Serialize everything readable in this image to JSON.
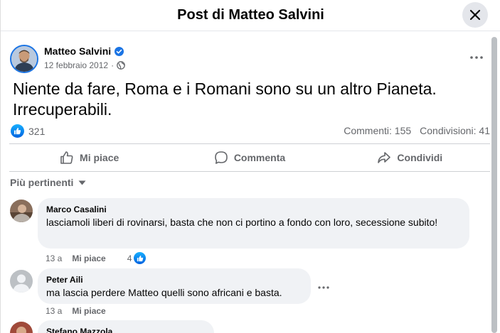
{
  "modal": {
    "title": "Post di Matteo Salvini"
  },
  "post": {
    "author": "Matteo Salvini",
    "date": "12 febbraio 2012",
    "separator": "·",
    "text": "Niente da fare, Roma e i Romani sono su un altro Pianeta. Irrecuperabili.",
    "like_count": "321",
    "comments_label": "Commenti: 155",
    "shares_label": "Condivisioni: 41"
  },
  "actions": {
    "like": "Mi piace",
    "comment": "Commenta",
    "share": "Condividi"
  },
  "sort": {
    "label": "Più pertinenti"
  },
  "comments": [
    {
      "author": "Marco Casalini",
      "text": "lasciamoli liberi di rovinarsi, basta che non ci portino a fondo con loro, secessione subito!",
      "time": "13 a",
      "like_label": "Mi piace",
      "reactions": "4"
    },
    {
      "author": "Peter Aili",
      "text": "ma lascia perdere Matteo quelli sono africani e basta.",
      "time": "13 a",
      "like_label": "Mi piace"
    },
    {
      "author": "Stefano Mazzola"
    }
  ],
  "colors": {
    "accent": "#1b74e4",
    "muted": "#65676b",
    "bubble": "#f0f2f5"
  }
}
